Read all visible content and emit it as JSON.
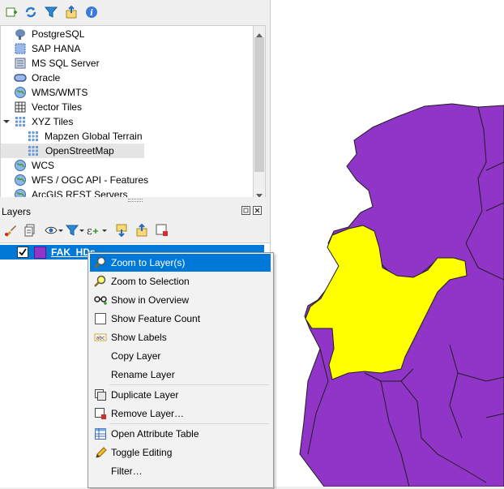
{
  "browser": {
    "items": [
      {
        "label": "PostgreSQL",
        "icon": "postgresql-icon"
      },
      {
        "label": "SAP HANA",
        "icon": "sap-hana-icon"
      },
      {
        "label": "MS SQL Server",
        "icon": "mssql-icon"
      },
      {
        "label": "Oracle",
        "icon": "oracle-icon"
      },
      {
        "label": "WMS/WMTS",
        "icon": "globe-icon"
      },
      {
        "label": "Vector Tiles",
        "icon": "grid-icon"
      },
      {
        "label": "XYZ Tiles",
        "icon": "grid-icon"
      },
      {
        "label": "Mapzen Global Terrain",
        "icon": "grid-icon"
      },
      {
        "label": "OpenStreetMap",
        "icon": "grid-icon"
      },
      {
        "label": "WCS",
        "icon": "globe-icon"
      },
      {
        "label": "WFS / OGC API - Features",
        "icon": "globe-icon"
      },
      {
        "label": "ArcGIS REST Servers",
        "icon": "globe-icon"
      }
    ]
  },
  "layers": {
    "title": "Layers",
    "layer_name": "FAK_HDs"
  },
  "context_menu": {
    "items": [
      {
        "label": "Zoom to Layer(s)"
      },
      {
        "label": "Zoom to Selection"
      },
      {
        "label": "Show in Overview"
      },
      {
        "label": "Show Feature Count"
      },
      {
        "label": "Show Labels"
      },
      {
        "label": "Copy Layer"
      },
      {
        "label": "Rename Layer"
      },
      {
        "label": "Duplicate Layer"
      },
      {
        "label": "Remove Layer…"
      },
      {
        "label": "Open Attribute Table"
      },
      {
        "label": "Toggle Editing"
      },
      {
        "label": "Filter…"
      }
    ]
  },
  "colors": {
    "selection": "#0078d7",
    "polygon_fill": "#9134c8",
    "selected_polygon_fill": "#ffff00",
    "polygon_stroke": "#1e1e1e"
  }
}
